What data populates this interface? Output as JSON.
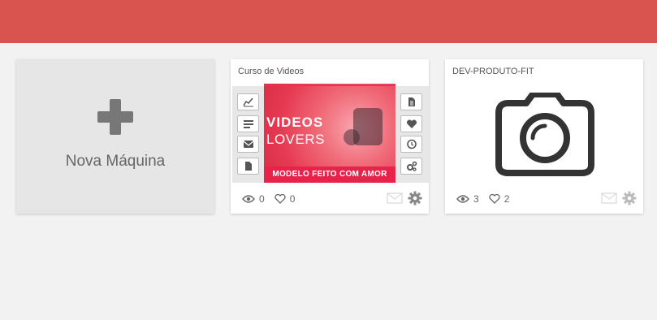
{
  "colors": {
    "topbar": "#d9534f",
    "background": "#f2f2f2",
    "accent": "#e8234a"
  },
  "new_machine": {
    "label": "Nova Máquina",
    "icon": "plus-icon"
  },
  "cards": [
    {
      "title": "Curso de Videos",
      "thumbnail": {
        "line1": "VIDEOS",
        "line2": "LOVERS",
        "tagline": "MODELO FEITO COM AMOR"
      },
      "left_tools": [
        "chart-icon",
        "list-icon",
        "envelope-icon",
        "document-icon"
      ],
      "right_tools": [
        "file-text-icon",
        "heart-icon",
        "clock-icon",
        "cogs-icon"
      ],
      "views": "0",
      "likes": "0"
    },
    {
      "title": "DEV-PRODUTO-FIT",
      "thumbnail_icon": "camera-icon",
      "views": "3",
      "likes": "2"
    }
  ]
}
